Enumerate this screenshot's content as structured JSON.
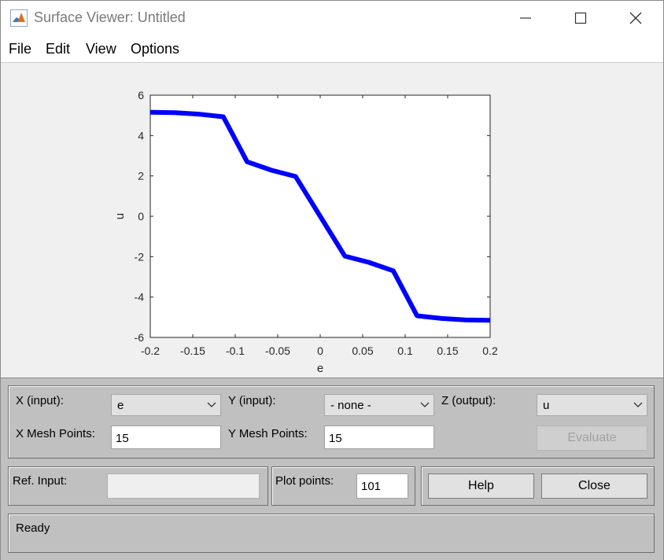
{
  "window": {
    "title": "Surface Viewer: Untitled",
    "controls": [
      "minimize-icon",
      "maximize-icon",
      "close-icon"
    ]
  },
  "menu": [
    "File",
    "Edit",
    "View",
    "Options"
  ],
  "chart_data": {
    "type": "line",
    "xlabel": "e",
    "ylabel": "u",
    "xlim": [
      -0.2,
      0.2
    ],
    "ylim": [
      -6,
      6
    ],
    "xticks": [
      "-0.2",
      "-0.15",
      "-0.1",
      "-0.05",
      "0",
      "0.05",
      "0.1",
      "0.15",
      "0.2"
    ],
    "yticks": [
      "6",
      "4",
      "2",
      "0",
      "-2",
      "-4",
      "-6"
    ],
    "grid": false,
    "series": [
      {
        "color": "#0000ff",
        "x": [
          -0.2,
          -0.171,
          -0.143,
          -0.114,
          -0.086,
          -0.057,
          -0.029,
          0.0,
          0.029,
          0.057,
          0.086,
          0.114,
          0.143,
          0.171,
          0.2
        ],
        "y": [
          5.15,
          5.13,
          5.06,
          4.93,
          2.7,
          2.28,
          1.97,
          0.0,
          -1.97,
          -2.28,
          -2.7,
          -4.93,
          -5.06,
          -5.13,
          -5.15
        ]
      }
    ]
  },
  "controls": {
    "x_input_label": "X (input):",
    "x_input_value": "e",
    "y_input_label": "Y (input):",
    "y_input_value": "- none -",
    "z_output_label": "Z (output):",
    "z_output_value": "u",
    "x_mesh_label": "X Mesh Points:",
    "x_mesh_value": "15",
    "y_mesh_label": "Y Mesh Points:",
    "y_mesh_value": "15",
    "evaluate_label": "Evaluate",
    "ref_input_label": "Ref. Input:",
    "ref_input_value": "",
    "plot_points_label": "Plot points:",
    "plot_points_value": "101",
    "help_label": "Help",
    "close_label": "Close"
  },
  "status": {
    "text": "Ready"
  }
}
